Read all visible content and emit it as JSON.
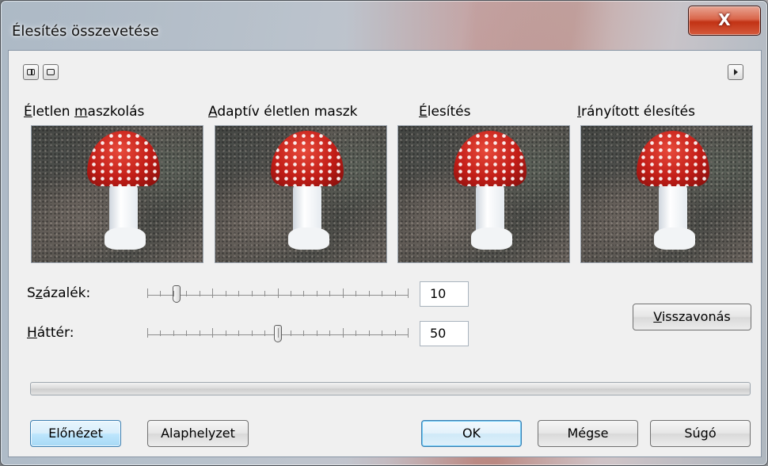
{
  "window": {
    "title": "Élesítés összevetése",
    "close_glyph": "X"
  },
  "toolbar": {
    "icons": [
      "split-view-icon",
      "single-view-icon",
      "play-icon"
    ]
  },
  "previews": [
    {
      "label_ul": "",
      "label_key": "É",
      "label_rest": "letlen ",
      "label_ul2": "m",
      "label_rest2": "aszkolás"
    },
    {
      "label_ul": "",
      "label_key": "A",
      "label_rest": "daptív életlen maszk",
      "label_ul2": "",
      "label_rest2": ""
    },
    {
      "label_ul": "",
      "label_key": "É",
      "label_rest": "lesítés",
      "label_ul2": "",
      "label_rest2": ""
    },
    {
      "label_ul": "",
      "label_key": "I",
      "label_rest": "rányított élesítés",
      "label_ul2": "",
      "label_rest2": ""
    }
  ],
  "controls": {
    "percent": {
      "label_pre": "S",
      "label_key": "z",
      "label_post": "ázalék:",
      "value": "10",
      "level": 10
    },
    "background": {
      "label_pre": "",
      "label_key": "H",
      "label_post": "áttér:",
      "value": "50",
      "level": 50
    }
  },
  "buttons": {
    "reset_pre": "",
    "reset_key": "V",
    "reset_post": "isszavonás",
    "preview": "Előnézet",
    "default": "Alaphelyzet",
    "ok": "OK",
    "cancel": "Mégse",
    "help": "Súgó"
  }
}
